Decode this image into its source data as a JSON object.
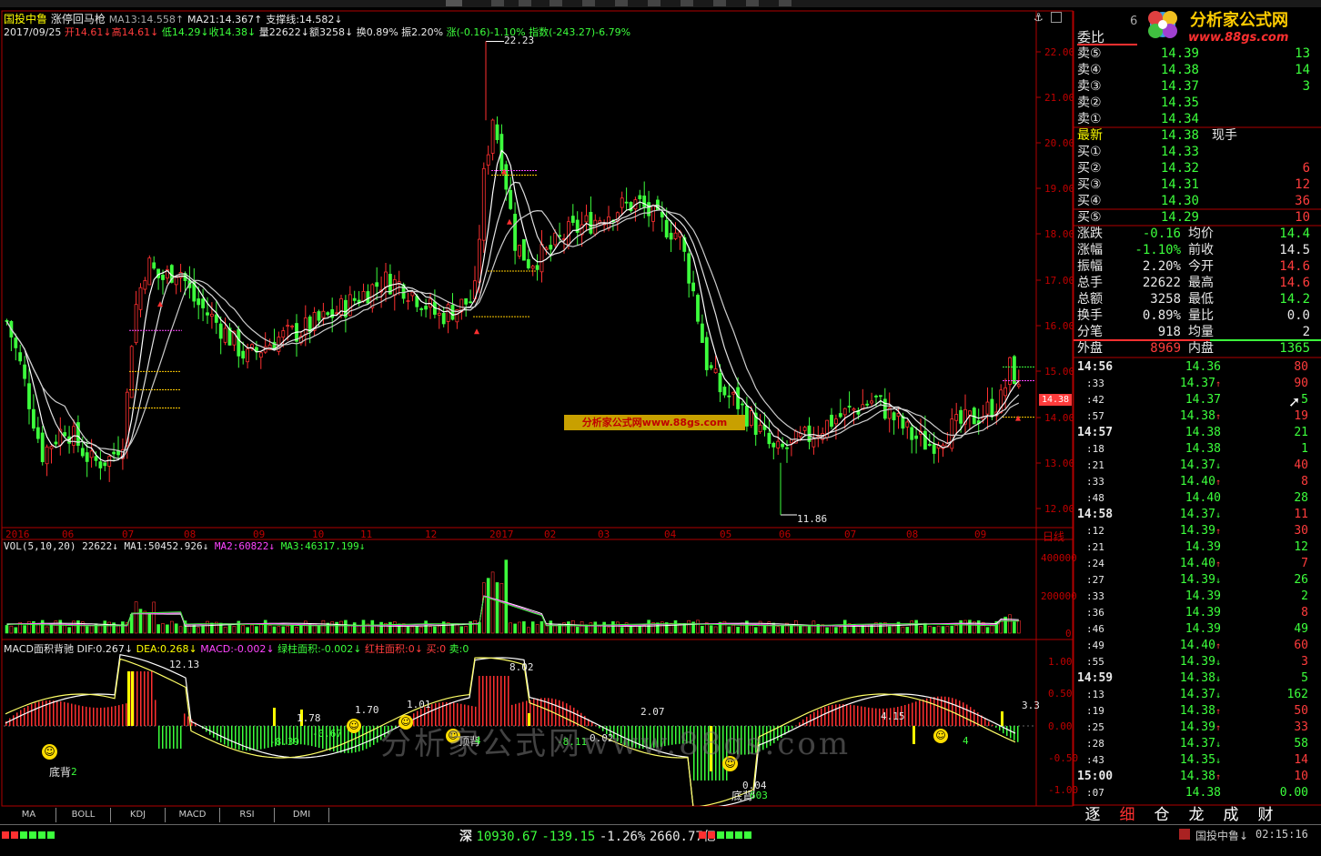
{
  "header": {
    "stock_name": "国投中鲁",
    "indicator_name": "涨停回马枪",
    "ma13": "MA13:14.558↑",
    "ma21": "MA21:14.367↑",
    "support": "支撑线:14.582↓",
    "date": "2017/09/25",
    "open": "开14.61↓",
    "high": "高14.61↓",
    "low": "低14.29↓",
    "close": "收14.38↓",
    "volume": "量22622↓",
    "amount": "额3258↓",
    "turnover": "换0.89%",
    "amplitude": "振2.20%",
    "change": "涨(-0.16)-1.10%",
    "index_change": "指数(-243.27)-6.79%"
  },
  "price_axis": [
    "22.00",
    "21.00",
    "20.00",
    "19.00",
    "18.00",
    "17.00",
    "16.00",
    "15.00",
    "14.00",
    "13.00",
    "12.00"
  ],
  "time_axis": [
    "2016",
    "06",
    "07",
    "08",
    "09",
    "10",
    "11",
    "12",
    "2017",
    "02",
    "03",
    "04",
    "05",
    "06",
    "07",
    "08",
    "09"
  ],
  "time_axis_right": "日线",
  "annotations": {
    "peak": "22.23",
    "trough": "11.86",
    "current_price": "14.38",
    "watermark_small": "分析家公式网www.88gs.com",
    "watermark_big": "分析家公式网www.88gs.com"
  },
  "vol_header": {
    "name": "VOL(5,10,20)",
    "value": "22622↓",
    "ma1": "MA1:50452.926↓",
    "ma2": "MA2:60822↓",
    "ma3": "MA3:46317.199↓"
  },
  "vol_axis": [
    "400000",
    "200000",
    "0"
  ],
  "macd_header": {
    "name": "MACD面积背驰",
    "dif": "DIF:0.267↓",
    "dea": "DEA:0.268↓",
    "macd": "MACD:-0.002↓",
    "green_area": "绿柱面积:-0.002↓",
    "red_area": "红柱面积:0↓",
    "buy": "买:0",
    "sell": "卖:0"
  },
  "macd_axis": [
    "1.00",
    "0.50",
    "0.00",
    "-0.50",
    "-1.00"
  ],
  "macd_labels": [
    "12.13",
    "8.02",
    "1.78",
    "-0.67",
    "1.70",
    "1.01",
    "2.07",
    "-8.39",
    "-8.11",
    "0.02",
    "0.04",
    "4.15",
    "3.3",
    "底背",
    "顶背",
    "底背",
    "2",
    "4",
    "4",
    "603"
  ],
  "bottom_tabs": [
    "MA",
    "BOLL",
    "KDJ",
    "MACD",
    "RSI",
    "DMI"
  ],
  "right_tabs": [
    "逐",
    "细",
    "仓",
    "龙",
    "成",
    "财"
  ],
  "logo": {
    "line1": "分析家公式网",
    "line2": "www.88gs.com"
  },
  "quote": {
    "ratio_label": "委比",
    "asks": [
      {
        "label": "卖⑤",
        "price": "14.39",
        "vol": "13"
      },
      {
        "label": "卖④",
        "price": "14.38",
        "vol": "14"
      },
      {
        "label": "卖③",
        "price": "14.37",
        "vol": "3"
      },
      {
        "label": "卖②",
        "price": "14.35",
        "vol": ""
      },
      {
        "label": "卖①",
        "price": "14.34",
        "vol": ""
      }
    ],
    "last": {
      "label": "最新",
      "price": "14.38",
      "extra": "现手"
    },
    "bids": [
      {
        "label": "买①",
        "price": "14.33",
        "vol": ""
      },
      {
        "label": "买②",
        "price": "14.32",
        "vol": "6"
      },
      {
        "label": "买③",
        "price": "14.31",
        "vol": "12"
      },
      {
        "label": "买④",
        "price": "14.30",
        "vol": "36"
      },
      {
        "label": "买⑤",
        "price": "14.29",
        "vol": "10"
      }
    ],
    "stats": [
      {
        "k1": "涨跌",
        "v1": "-0.16",
        "k2": "均价",
        "v2": "14.4"
      },
      {
        "k1": "涨幅",
        "v1": "-1.10%",
        "k2": "前收",
        "v2": "14.5"
      },
      {
        "k1": "振幅",
        "v1": "2.20%",
        "k2": "今开",
        "v2": "14.6"
      },
      {
        "k1": "总手",
        "v1": "22622",
        "k2": "最高",
        "v2": "14.6"
      },
      {
        "k1": "总额",
        "v1": "3258",
        "k2": "最低",
        "v2": "14.2"
      },
      {
        "k1": "换手",
        "v1": "0.89%",
        "k2": "量比",
        "v2": "0.0"
      },
      {
        "k1": "分笔",
        "v1": "918",
        "k2": "均量",
        "v2": "2"
      },
      {
        "k1": "外盘",
        "v1": "8969",
        "k2": "内盘",
        "v2": "1365"
      }
    ]
  },
  "ticks": [
    {
      "t": "14:56",
      "p": "14.36",
      "a": "",
      "v": "80",
      "big": true
    },
    {
      "t": ":33",
      "p": "14.37",
      "a": "↑",
      "v": "90"
    },
    {
      "t": ":42",
      "p": "14.37",
      "a": "",
      "v": "5"
    },
    {
      "t": ":57",
      "p": "14.38",
      "a": "↑",
      "v": "19"
    },
    {
      "t": "14:57",
      "p": "14.38",
      "a": "",
      "v": "21",
      "big": true
    },
    {
      "t": ":18",
      "p": "14.38",
      "a": "",
      "v": "1"
    },
    {
      "t": ":21",
      "p": "14.37",
      "a": "↓",
      "v": "40"
    },
    {
      "t": ":33",
      "p": "14.40",
      "a": "↑",
      "v": "8"
    },
    {
      "t": ":48",
      "p": "14.40",
      "a": "",
      "v": "28"
    },
    {
      "t": "14:58",
      "p": "14.37",
      "a": "↓",
      "v": "11",
      "big": true
    },
    {
      "t": ":12",
      "p": "14.39",
      "a": "↑",
      "v": "30"
    },
    {
      "t": ":21",
      "p": "14.39",
      "a": "",
      "v": "12"
    },
    {
      "t": ":24",
      "p": "14.40",
      "a": "↑",
      "v": "7"
    },
    {
      "t": ":27",
      "p": "14.39",
      "a": "↓",
      "v": "26"
    },
    {
      "t": ":33",
      "p": "14.39",
      "a": "",
      "v": "2"
    },
    {
      "t": ":36",
      "p": "14.39",
      "a": "",
      "v": "8"
    },
    {
      "t": ":46",
      "p": "14.39",
      "a": "",
      "v": "49"
    },
    {
      "t": ":49",
      "p": "14.40",
      "a": "↑",
      "v": "60"
    },
    {
      "t": ":55",
      "p": "14.39",
      "a": "↓",
      "v": "3"
    },
    {
      "t": "14:59",
      "p": "14.38",
      "a": "↓",
      "v": "5",
      "big": true
    },
    {
      "t": ":13",
      "p": "14.37",
      "a": "↓",
      "v": "162"
    },
    {
      "t": ":19",
      "p": "14.38",
      "a": "↑",
      "v": "50"
    },
    {
      "t": ":25",
      "p": "14.39",
      "a": "↑",
      "v": "33"
    },
    {
      "t": ":28",
      "p": "14.37",
      "a": "↓",
      "v": "58"
    },
    {
      "t": ":43",
      "p": "14.35",
      "a": "↓",
      "v": "14"
    },
    {
      "t": "15:00",
      "p": "14.38",
      "a": "↑",
      "v": "10",
      "big": true
    },
    {
      "t": ":07",
      "p": "14.38",
      "a": "",
      "v": "0.00"
    }
  ],
  "status_bar": {
    "market": "深",
    "index": "10930.67",
    "change": "-139.15",
    "pct": "-1.26%",
    "amount": "2660.77亿",
    "stock": "国投中鲁↓",
    "time": "02:15:16"
  },
  "colors": {
    "up": "#ff3c3c",
    "down": "#3cff3c",
    "axis": "#c00000",
    "text": "#e8e8e8"
  }
}
